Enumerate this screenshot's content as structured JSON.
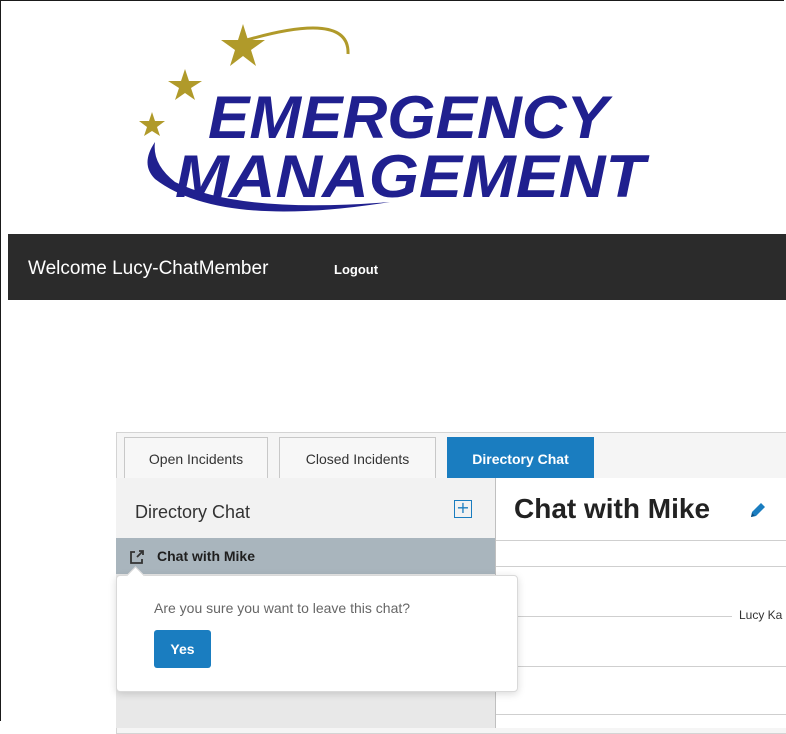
{
  "logo": {
    "line1": "EMERGENCY",
    "line2": "MANAGEMENT",
    "brand_color": "#20208f",
    "star_color": "#b09a2a"
  },
  "navbar": {
    "welcome": "Welcome Lucy-ChatMember",
    "logout": "Logout",
    "bg": "#2b2b2b"
  },
  "tabs": [
    {
      "label": "Open Incidents",
      "active": false
    },
    {
      "label": "Closed Incidents",
      "active": false
    },
    {
      "label": "Directory Chat",
      "active": true
    }
  ],
  "sidebar": {
    "title": "Directory Chat",
    "add_icon": "plus-square-icon",
    "items": [
      {
        "label": "Chat with Mike",
        "icon": "external-link-icon"
      }
    ]
  },
  "main": {
    "title": "Chat with Mike",
    "edit_icon": "pencil-icon",
    "message_sender": "Lucy Ka"
  },
  "popover": {
    "text": "Are you sure you want to leave this chat?",
    "yes": "Yes"
  },
  "colors": {
    "accent": "#1a7dc0",
    "selected_item": "#a9b5bd"
  }
}
